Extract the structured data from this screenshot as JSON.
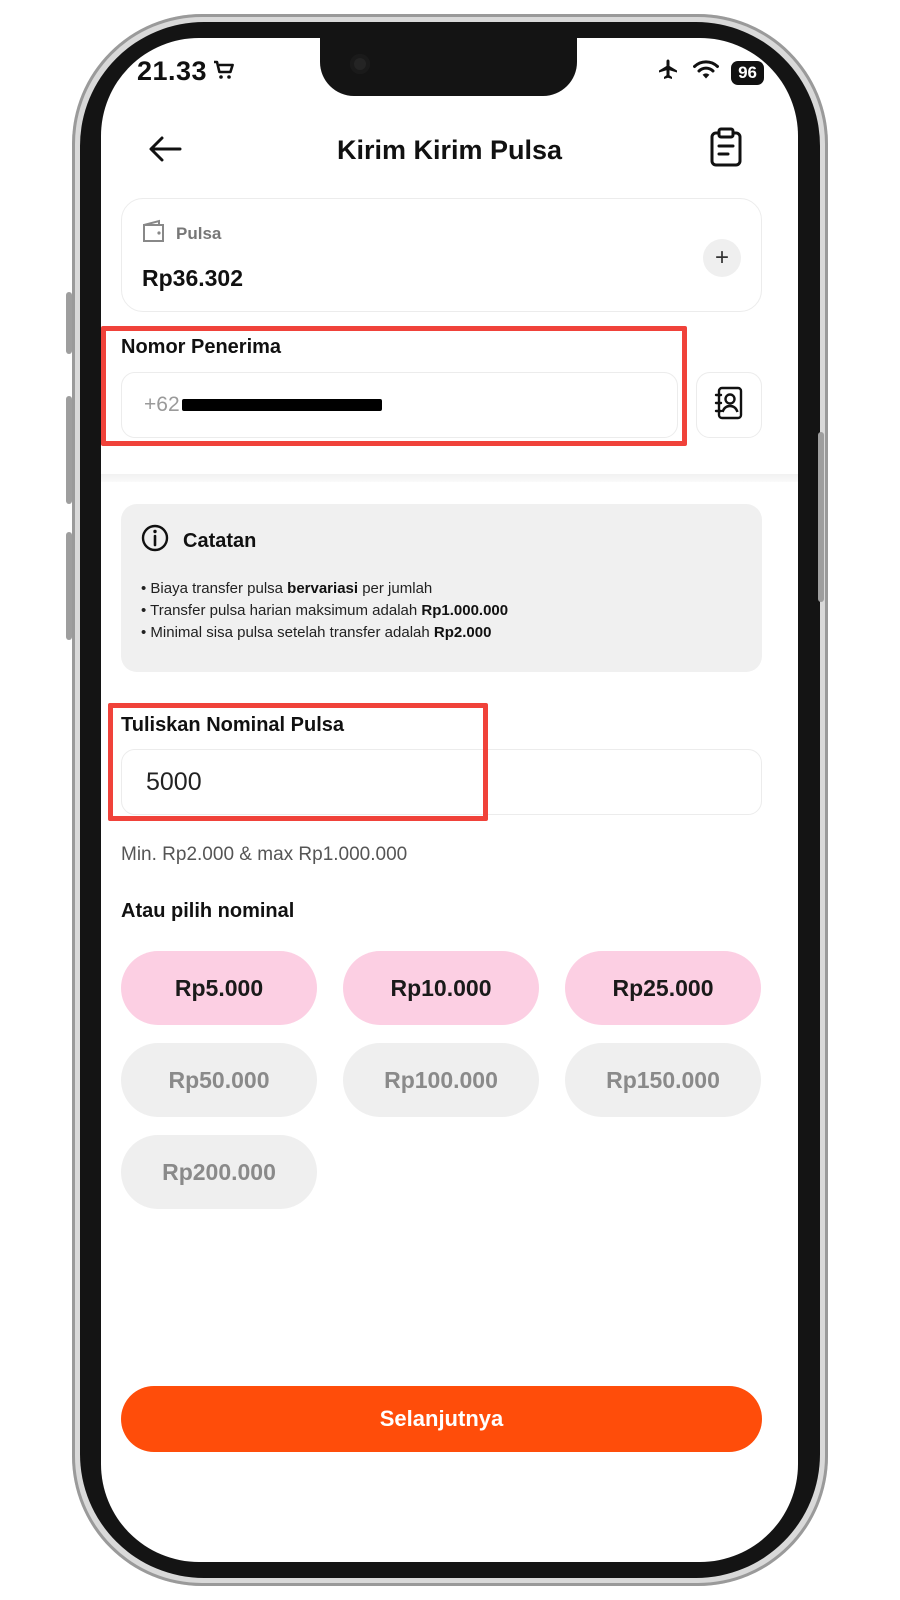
{
  "status_bar": {
    "time": "21.33",
    "battery": "96"
  },
  "header": {
    "title": "Kirim Kirim Pulsa"
  },
  "balance": {
    "label": "Pulsa",
    "value": "Rp36.302"
  },
  "recipient": {
    "label": "Nomor Penerima",
    "prefix": "+62"
  },
  "note": {
    "title": "Catatan",
    "lines": [
      {
        "pre": "• Biaya transfer pulsa ",
        "bold": "bervariasi",
        "post": " per jumlah"
      },
      {
        "pre": "• Transfer pulsa harian maksimum adalah ",
        "bold": "Rp1.000.000",
        "post": ""
      },
      {
        "pre": "• Minimal sisa pulsa setelah transfer adalah ",
        "bold": "Rp2.000",
        "post": ""
      }
    ]
  },
  "nominal": {
    "label": "Tuliskan Nominal Pulsa",
    "value": "5000",
    "hint": "Min. Rp2.000 & max Rp1.000.000"
  },
  "choose": {
    "label": "Atau pilih nominal",
    "options": [
      "Rp5.000",
      "Rp10.000",
      "Rp25.000",
      "Rp50.000",
      "Rp100.000",
      "Rp150.000",
      "Rp200.000"
    ]
  },
  "cta": {
    "label": "Selanjutnya"
  },
  "colors": {
    "accent": "#ff4d0a",
    "chip_active": "#fccfe3",
    "chip_disabled": "#efefef",
    "highlight": "#f0423a"
  }
}
